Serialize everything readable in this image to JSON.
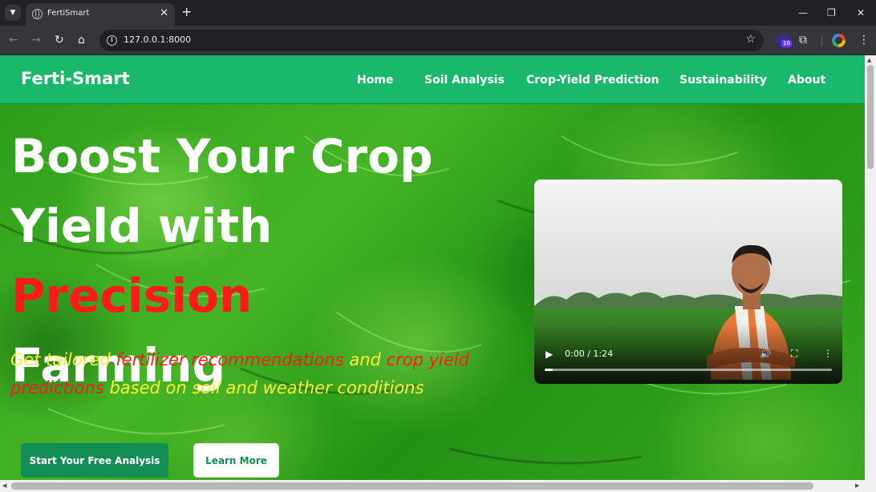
{
  "browser": {
    "tab_title": "FertiSmart",
    "url": "127.0.0.1:8000",
    "extension_badge": "16"
  },
  "navbar": {
    "brand": "Ferti-Smart",
    "links": [
      "Home",
      "Soil Analysis",
      "Crop-Yield Prediction",
      "Sustainability",
      "About"
    ]
  },
  "hero": {
    "headline_line1": "Boost Your Crop",
    "headline_line2_start": "Yield with ",
    "headline_accent": "Precision",
    "headline_line3": "Farming",
    "sub_part1": "Get tailored ",
    "sub_red1": "fertilizer recommendations",
    "sub_part2": " and ",
    "sub_red2": "crop yield predictions",
    "sub_part3": " based on soil and weather conditions",
    "primary_button": "Start Your Free Analysis",
    "secondary_button": "Learn More"
  },
  "video": {
    "time": "0:00 / 1:24",
    "progress": 0.0
  },
  "colors": {
    "navbar": "#19b86a",
    "accent_red": "#ff1a1a",
    "subtitle_yellow": "#ffeb3b",
    "button_green": "#138f55"
  }
}
